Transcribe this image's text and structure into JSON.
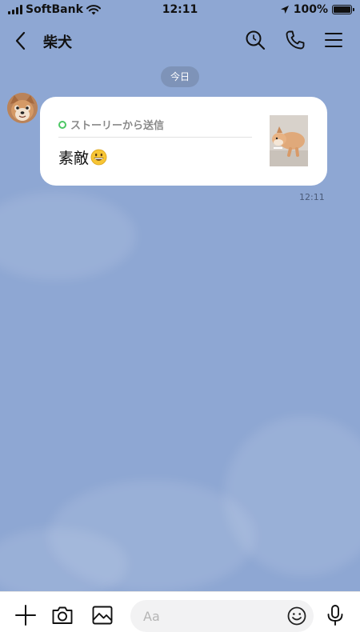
{
  "status_bar": {
    "carrier": "SoftBank",
    "time": "12:11",
    "battery": "100%",
    "icons": [
      "signal-icon",
      "wifi-icon",
      "location-icon",
      "battery-icon"
    ]
  },
  "header": {
    "title": "柴犬",
    "icons": [
      "back-icon",
      "search-icon",
      "phone-icon",
      "menu-icon"
    ]
  },
  "chat": {
    "date_label": "今日",
    "messages": [
      {
        "story_label": "ストーリーから送信",
        "text": "素敵",
        "emoji": "grinning-face-emoji",
        "time": "12:11"
      }
    ]
  },
  "input_bar": {
    "placeholder": "Aa",
    "icons": [
      "plus-icon",
      "camera-icon",
      "image-icon",
      "emoji-icon",
      "microphone-icon"
    ]
  },
  "colors": {
    "background": "#8ea7d3",
    "bubble": "#ffffff",
    "story_accent": "#4cc764",
    "input_bg": "#f2f2f3"
  }
}
